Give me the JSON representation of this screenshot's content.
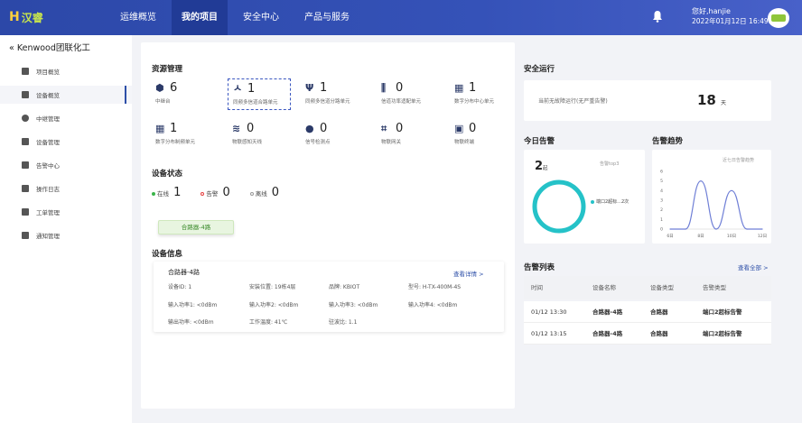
{
  "header": {
    "logo_mark": "H",
    "logo_text": "汉睿",
    "nav": [
      "运维概览",
      "我的项目",
      "安全中心",
      "产品与服务"
    ],
    "active_nav": 1,
    "greeting": "您好,hanjie",
    "datetime": "2022年01月12日 16:49:50"
  },
  "sidebar": {
    "title": "Kenwood团联化工",
    "items": [
      "项目概览",
      "设备概览",
      "中继管理",
      "设备管理",
      "告警中心",
      "操作日志",
      "工单管理",
      "通知管理"
    ],
    "active": 1
  },
  "resource": {
    "title": "资源管理",
    "items": [
      {
        "num": "6",
        "label": "中继台"
      },
      {
        "num": "1",
        "label": "同频多信道合路单元"
      },
      {
        "num": "1",
        "label": "同频多信道分路单元"
      },
      {
        "num": "0",
        "label": "信道功率适配单元"
      },
      {
        "num": "1",
        "label": "数字分布中心单元"
      },
      {
        "num": "1",
        "label": "数字分布制频单元"
      },
      {
        "num": "0",
        "label": "物联感知天线"
      },
      {
        "num": "0",
        "label": "信号检测点"
      },
      {
        "num": "0",
        "label": "物联网关"
      },
      {
        "num": "0",
        "label": "物联终端"
      }
    ]
  },
  "status": {
    "title": "设备状态",
    "online_label": "在线",
    "online": "1",
    "alarm_label": "告警",
    "alarm": "0",
    "offline_label": "离线",
    "offline": "0",
    "tag": "合路器-4路"
  },
  "info": {
    "title": "设备信息",
    "name": "合路器-4路",
    "detail_link": "查看详情 >",
    "fields": [
      "设备ID:  1",
      "安装位置:  19栋4层",
      "品牌:  KBIOT",
      "型号:  H-TX-400M-4S",
      "输入功率1:  <0dBm",
      "输入功率2:  <0dBm",
      "输入功率3:  <0dBm",
      "输入功率4:  <0dBm",
      "输出功率:  <0dBm",
      "工作温度:  41℃",
      "驻波比:  1.1"
    ]
  },
  "safety": {
    "title": "安全运行",
    "text": "当前无故障运行(无严重告警)",
    "days": "18",
    "unit": "天"
  },
  "today": {
    "title": "今日告警",
    "count": "2",
    "unit": "起",
    "top_label": "告警top3",
    "legend": "端口2超标...2次"
  },
  "trend": {
    "title": "告警趋势",
    "subtitle": "近七日告警趋势",
    "yticks": [
      "6",
      "5",
      "4",
      "3",
      "2",
      "1",
      "0"
    ],
    "xticks": [
      "6日",
      "8日",
      "10日",
      "12日"
    ]
  },
  "alarms": {
    "title": "告警列表",
    "view_all": "查看全部 >",
    "headers": [
      "时间",
      "设备名称",
      "设备类型",
      "告警类型"
    ],
    "rows": [
      [
        "01/12 13:30",
        "合路器-4路",
        "合路器",
        "端口2超标告警"
      ],
      [
        "01/12 13:15",
        "合路器-4路",
        "合路器",
        "端口2超标告警"
      ]
    ]
  },
  "colors": {
    "brand": "#2c48a8",
    "online": "#3ab54a",
    "alarm": "#e53e3e",
    "donut": "#25c2c8",
    "trend": "#6f7fd6"
  },
  "chart_data": [
    {
      "type": "pie",
      "title": "今日告警",
      "categories": [
        "端口2超标"
      ],
      "values": [
        2
      ]
    },
    {
      "type": "line",
      "title": "近七日告警趋势",
      "x": [
        "6日",
        "7日",
        "8日",
        "9日",
        "10日",
        "11日",
        "12日"
      ],
      "values": [
        0,
        0,
        5,
        0,
        4,
        0,
        0
      ],
      "ylim": [
        0,
        6
      ],
      "xlabel": "",
      "ylabel": ""
    }
  ]
}
